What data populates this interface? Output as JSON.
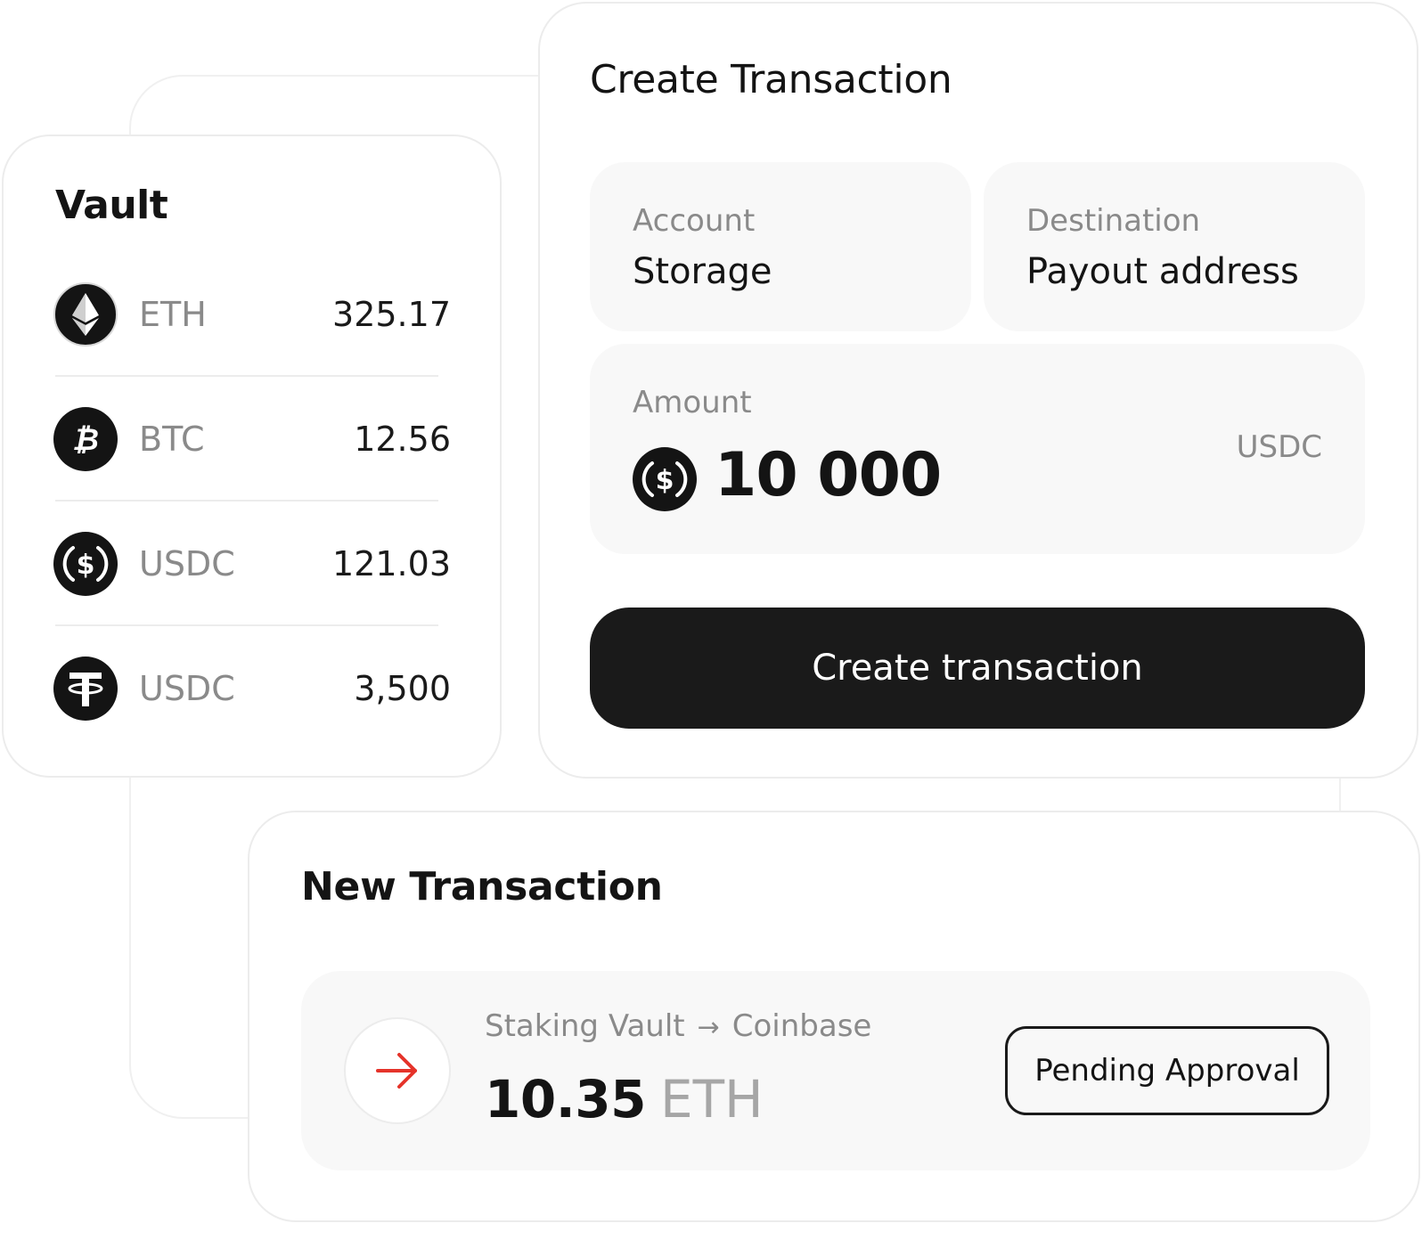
{
  "vault": {
    "title": "Vault",
    "assets": [
      {
        "icon": "ethereum-icon",
        "symbol": "ETH",
        "amount": "325.17"
      },
      {
        "icon": "bitcoin-icon",
        "symbol": "BTC",
        "amount": "12.56"
      },
      {
        "icon": "usdc-icon",
        "symbol": "USDC",
        "amount": "121.03"
      },
      {
        "icon": "tether-icon",
        "symbol": "USDC",
        "amount": "3,500"
      }
    ]
  },
  "create_transaction": {
    "title": "Create Transaction",
    "account": {
      "label": "Account",
      "value": "Storage"
    },
    "destination": {
      "label": "Destination",
      "value": "Payout address"
    },
    "amount": {
      "label": "Amount",
      "value": "10 000",
      "currency": "USDC",
      "icon": "usdc-icon"
    },
    "button_label": "Create transaction"
  },
  "new_transaction": {
    "title": "New Transaction",
    "arrow_icon": "arrow-right-icon",
    "from": "Staking Vault",
    "route_arrow": "→",
    "to": "Coinbase",
    "amount": "10.35",
    "unit": "ETH",
    "status": "Pending Approval"
  },
  "colors": {
    "text": "#141414",
    "muted": "#8a8a8a",
    "button_bg": "#1a1a1a",
    "field_bg": "#f8f8f8",
    "accent_red": "#e5332a"
  }
}
